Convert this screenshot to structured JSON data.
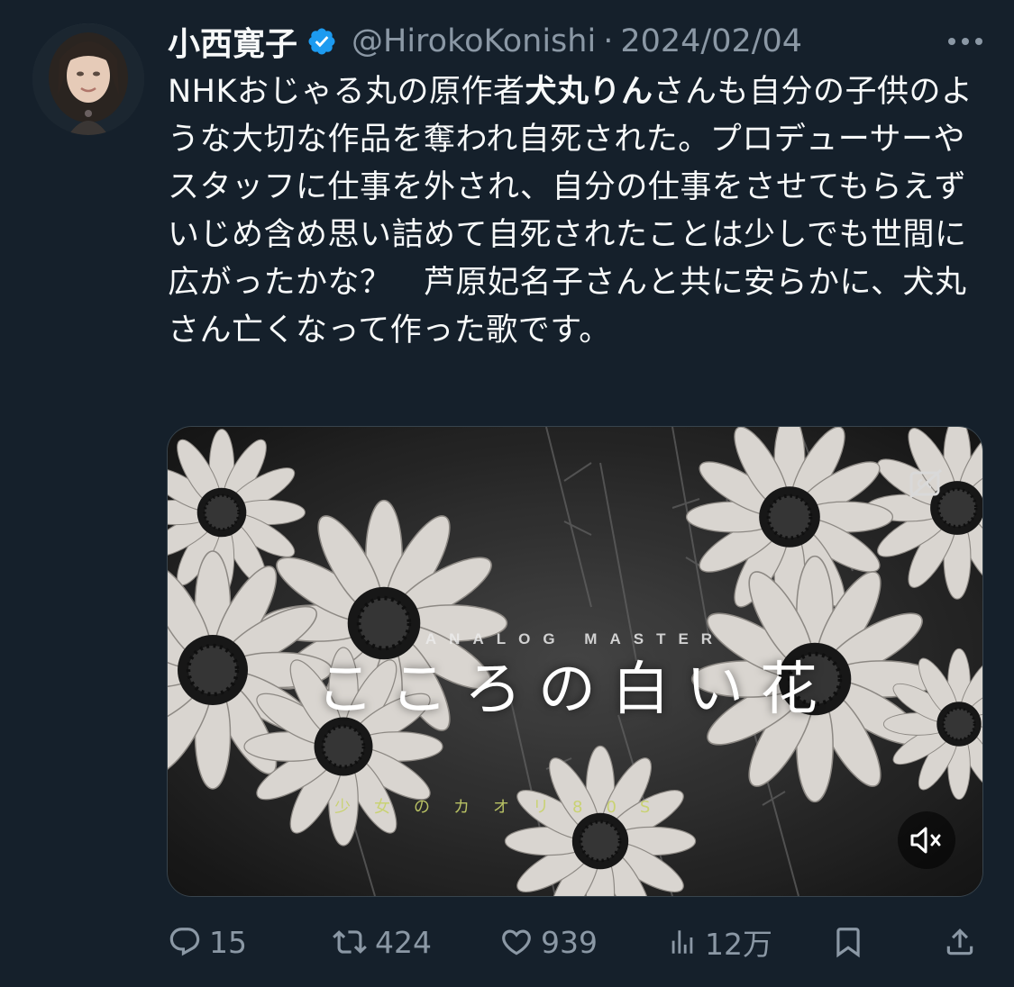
{
  "author": {
    "display_name": "小西寛子",
    "handle": "@HirokoKonishi",
    "separator": "·",
    "date": "2024/02/04",
    "avatar_icon": "avatar",
    "verified_icon": "verified-badge-icon",
    "verified_color": "#1d9bf0"
  },
  "tweet": {
    "text_part1": "NHKおじゃる丸の原作者",
    "text_bold": "犬丸りん",
    "text_part2": "さんも自分の子供のような大切な作品を奪われ自死された。プロデューサーやスタッフに仕事を外され、自分の仕事をさせてもらえずいじめ含め思い詰めて自死されたことは少しでも世間に広がったかな？　芦原妃名子さんと共に安らかに、犬丸さん亡くなって作った歌です。"
  },
  "media": {
    "type": "video",
    "brand_text": "ANALOG MASTER",
    "title": "こころの白い花",
    "subtitle": "少女のカオリ80S",
    "cc_icon": "closed-captions-icon",
    "mute_icon": "muted-speaker-icon"
  },
  "actions": {
    "replies": "15",
    "retweets": "424",
    "likes": "939",
    "views": "12万",
    "reply_icon": "reply-icon",
    "retweet_icon": "retweet-icon",
    "like_icon": "heart-icon",
    "views_icon": "views-chart-icon",
    "bookmark_icon": "bookmark-icon",
    "share_icon": "share-icon"
  },
  "colors": {
    "background": "#15202b",
    "text_primary": "#f7f9f9",
    "text_secondary": "#8b98a5",
    "accent": "#1d9bf0"
  }
}
